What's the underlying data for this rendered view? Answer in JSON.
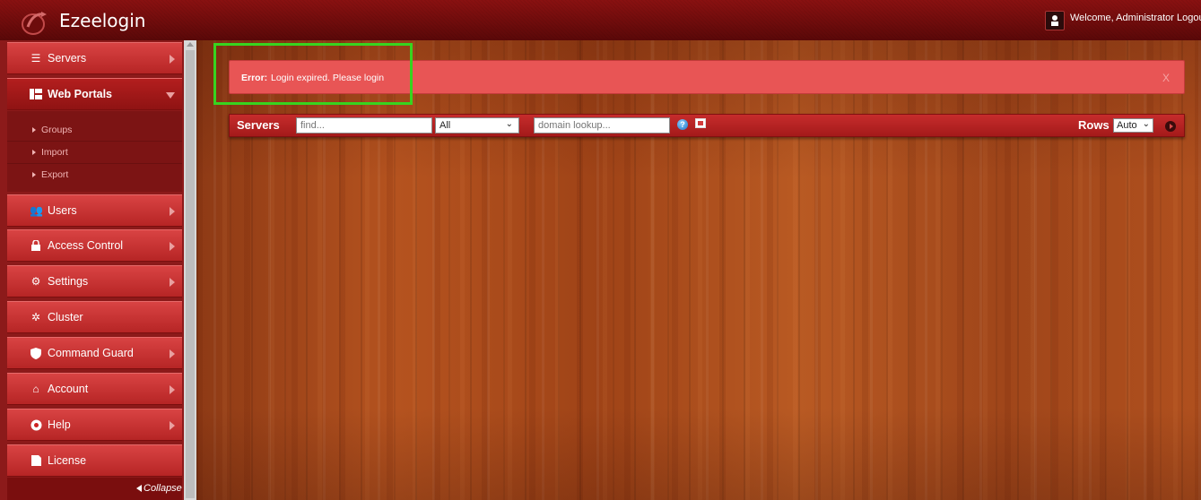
{
  "app": {
    "title": "Ezeelogin",
    "welcome": "Welcome, Administrator Logou"
  },
  "sidebar": {
    "items": [
      {
        "label": "Servers",
        "icon": "list-icon"
      },
      {
        "label": "Web Portals",
        "icon": "portal-icon"
      },
      {
        "label": "Users",
        "icon": "users-icon"
      },
      {
        "label": "Access Control",
        "icon": "lock-icon"
      },
      {
        "label": "Settings",
        "icon": "gears-icon"
      },
      {
        "label": "Cluster",
        "icon": "cluster-icon"
      },
      {
        "label": "Command Guard",
        "icon": "shield-icon"
      },
      {
        "label": "Account",
        "icon": "home-icon"
      },
      {
        "label": "Help",
        "icon": "lifebuoy-icon"
      },
      {
        "label": "License",
        "icon": "license-icon"
      }
    ],
    "submenu": [
      "Groups",
      "Import",
      "Export"
    ],
    "collapse_label": "Collapse"
  },
  "alert": {
    "strong": "Error:",
    "message": "Login expired. Please login",
    "close": "X"
  },
  "toolbar": {
    "title": "Servers",
    "find_placeholder": "find...",
    "filter_value": "All",
    "domain_placeholder": "domain lookup...",
    "rows_label": "Rows",
    "rows_value": "Auto"
  },
  "colors": {
    "accent": "#c62c2c",
    "highlight": "#37d41f",
    "alert": "#e85555"
  }
}
